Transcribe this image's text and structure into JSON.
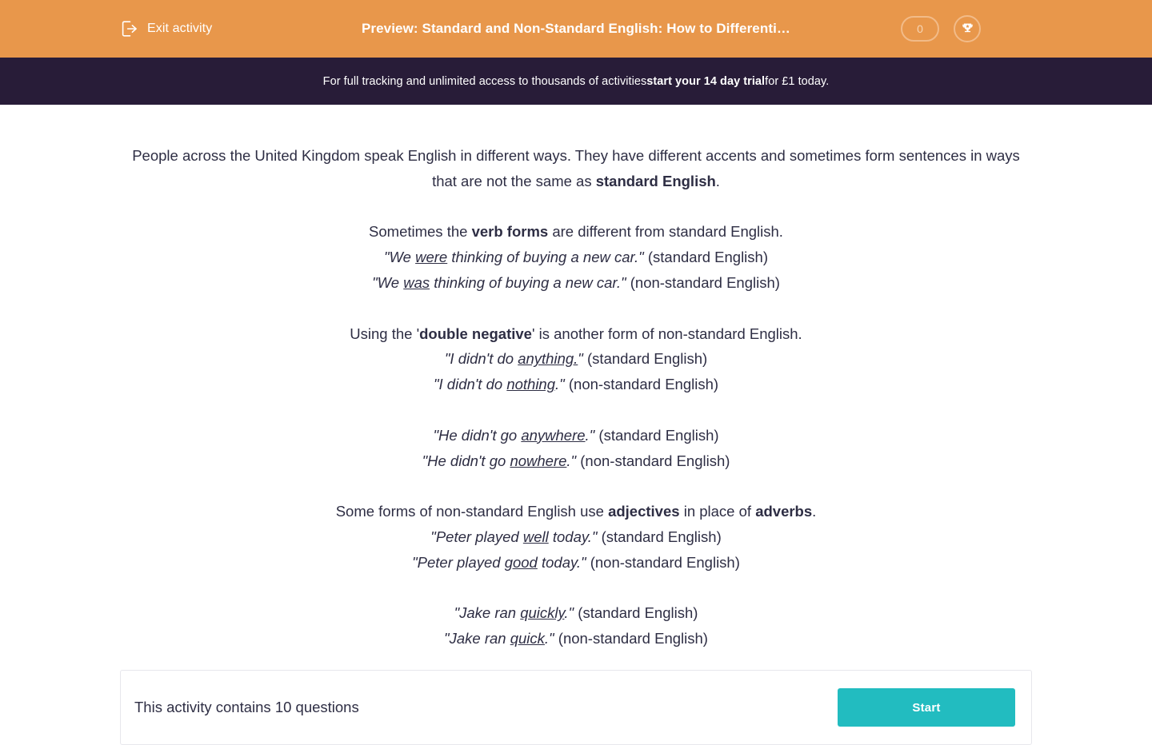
{
  "topbar": {
    "exit_label": "Exit activity",
    "exit_icon": "exit-arrow-icon",
    "title": "Preview: Standard and Non-Standard English: How to Differenti…",
    "score": "0",
    "trophy_icon": "trophy-icon",
    "background_color": "#e8974b"
  },
  "trial_banner": {
    "lead": "For full tracking and unlimited access to thousands of activities ",
    "emphasis": "start your 14 day trial",
    "tail": " for £1 today.",
    "background_color": "#281c38"
  },
  "content": {
    "intro": {
      "text_a": "People across the United Kingdom speak English in different ways. They have different accents and sometimes form sentences in ways that are not the same as ",
      "bold": "standard English",
      "text_b": "."
    },
    "verb_forms": {
      "heading_a": "Sometimes the ",
      "heading_bold": "verb forms",
      "heading_b": " are different from standard English.",
      "example_1_a": "\"We ",
      "example_1_ul": "were",
      "example_1_b": " thinking of buying a new car.\"",
      "example_1_tail": " (standard English)",
      "example_2_a": "\"We ",
      "example_2_ul": "was",
      "example_2_b": " thinking of buying a new car.\"",
      "example_2_tail": " (non-standard English)"
    },
    "double_negative": {
      "heading_a": "Using the '",
      "heading_bold": "double negative",
      "heading_b": "' is another form of non-standard English.",
      "example_1_a": "\"I didn't do ",
      "example_1_ul": "anything.",
      "example_1_b": "\"",
      "example_1_tail": " (standard English)",
      "example_2_a": "\"I didn't do ",
      "example_2_ul": "nothing",
      "example_2_b": ".\"",
      "example_2_tail": " (non-standard English)",
      "example_3_a": "\"He didn't go ",
      "example_3_ul": "anywhere",
      "example_3_b": ".\"",
      "example_3_tail": " (standard English)",
      "example_4_a": "\"He didn't go ",
      "example_4_ul": "nowhere",
      "example_4_b": ".\"",
      "example_4_tail": " (non-standard English)"
    },
    "adjectives": {
      "heading_a": "Some forms of non-standard English use ",
      "heading_bold_1": "adjectives",
      "heading_mid": " in place of ",
      "heading_bold_2": "adverbs",
      "heading_b": ".",
      "example_1_a": "\"Peter played ",
      "example_1_ul": "well",
      "example_1_b": " today.\"",
      "example_1_tail": " (standard English)",
      "example_2_a": "\"Peter played ",
      "example_2_ul": "good",
      "example_2_b": " today.\"",
      "example_2_tail": " (non-standard English)",
      "example_3_a": "\"Jake ran ",
      "example_3_ul": "quickly",
      "example_3_b": ".\"",
      "example_3_tail": " (standard English)",
      "example_4_a": "\"Jake ran ",
      "example_4_ul": "quick",
      "example_4_b": ".\"",
      "example_4_tail": " (non-standard English)"
    }
  },
  "activity_card": {
    "questions_text": "This activity contains 10 questions",
    "start_label": "Start",
    "start_color": "#22bcc0"
  }
}
